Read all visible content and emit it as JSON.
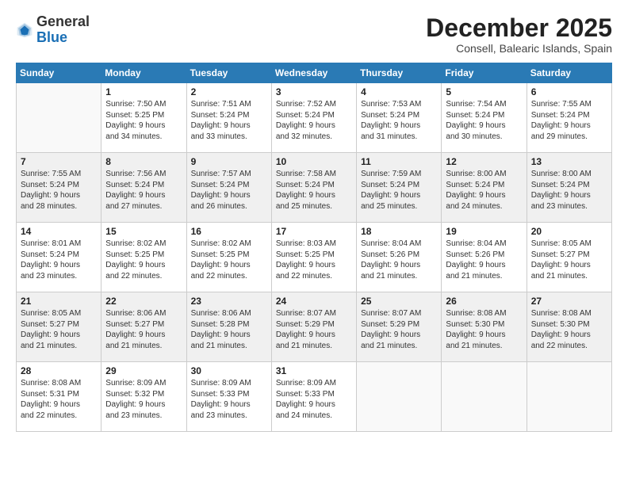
{
  "logo": {
    "general": "General",
    "blue": "Blue"
  },
  "header": {
    "month": "December 2025",
    "location": "Consell, Balearic Islands, Spain"
  },
  "weekdays": [
    "Sunday",
    "Monday",
    "Tuesday",
    "Wednesday",
    "Thursday",
    "Friday",
    "Saturday"
  ],
  "weeks": [
    [
      {
        "day": "",
        "sunrise": "",
        "sunset": "",
        "daylight": ""
      },
      {
        "day": "1",
        "sunrise": "Sunrise: 7:50 AM",
        "sunset": "Sunset: 5:25 PM",
        "daylight": "Daylight: 9 hours and 34 minutes."
      },
      {
        "day": "2",
        "sunrise": "Sunrise: 7:51 AM",
        "sunset": "Sunset: 5:24 PM",
        "daylight": "Daylight: 9 hours and 33 minutes."
      },
      {
        "day": "3",
        "sunrise": "Sunrise: 7:52 AM",
        "sunset": "Sunset: 5:24 PM",
        "daylight": "Daylight: 9 hours and 32 minutes."
      },
      {
        "day": "4",
        "sunrise": "Sunrise: 7:53 AM",
        "sunset": "Sunset: 5:24 PM",
        "daylight": "Daylight: 9 hours and 31 minutes."
      },
      {
        "day": "5",
        "sunrise": "Sunrise: 7:54 AM",
        "sunset": "Sunset: 5:24 PM",
        "daylight": "Daylight: 9 hours and 30 minutes."
      },
      {
        "day": "6",
        "sunrise": "Sunrise: 7:55 AM",
        "sunset": "Sunset: 5:24 PM",
        "daylight": "Daylight: 9 hours and 29 minutes."
      }
    ],
    [
      {
        "day": "7",
        "sunrise": "Sunrise: 7:55 AM",
        "sunset": "Sunset: 5:24 PM",
        "daylight": "Daylight: 9 hours and 28 minutes."
      },
      {
        "day": "8",
        "sunrise": "Sunrise: 7:56 AM",
        "sunset": "Sunset: 5:24 PM",
        "daylight": "Daylight: 9 hours and 27 minutes."
      },
      {
        "day": "9",
        "sunrise": "Sunrise: 7:57 AM",
        "sunset": "Sunset: 5:24 PM",
        "daylight": "Daylight: 9 hours and 26 minutes."
      },
      {
        "day": "10",
        "sunrise": "Sunrise: 7:58 AM",
        "sunset": "Sunset: 5:24 PM",
        "daylight": "Daylight: 9 hours and 25 minutes."
      },
      {
        "day": "11",
        "sunrise": "Sunrise: 7:59 AM",
        "sunset": "Sunset: 5:24 PM",
        "daylight": "Daylight: 9 hours and 25 minutes."
      },
      {
        "day": "12",
        "sunrise": "Sunrise: 8:00 AM",
        "sunset": "Sunset: 5:24 PM",
        "daylight": "Daylight: 9 hours and 24 minutes."
      },
      {
        "day": "13",
        "sunrise": "Sunrise: 8:00 AM",
        "sunset": "Sunset: 5:24 PM",
        "daylight": "Daylight: 9 hours and 23 minutes."
      }
    ],
    [
      {
        "day": "14",
        "sunrise": "Sunrise: 8:01 AM",
        "sunset": "Sunset: 5:24 PM",
        "daylight": "Daylight: 9 hours and 23 minutes."
      },
      {
        "day": "15",
        "sunrise": "Sunrise: 8:02 AM",
        "sunset": "Sunset: 5:25 PM",
        "daylight": "Daylight: 9 hours and 22 minutes."
      },
      {
        "day": "16",
        "sunrise": "Sunrise: 8:02 AM",
        "sunset": "Sunset: 5:25 PM",
        "daylight": "Daylight: 9 hours and 22 minutes."
      },
      {
        "day": "17",
        "sunrise": "Sunrise: 8:03 AM",
        "sunset": "Sunset: 5:25 PM",
        "daylight": "Daylight: 9 hours and 22 minutes."
      },
      {
        "day": "18",
        "sunrise": "Sunrise: 8:04 AM",
        "sunset": "Sunset: 5:26 PM",
        "daylight": "Daylight: 9 hours and 21 minutes."
      },
      {
        "day": "19",
        "sunrise": "Sunrise: 8:04 AM",
        "sunset": "Sunset: 5:26 PM",
        "daylight": "Daylight: 9 hours and 21 minutes."
      },
      {
        "day": "20",
        "sunrise": "Sunrise: 8:05 AM",
        "sunset": "Sunset: 5:27 PM",
        "daylight": "Daylight: 9 hours and 21 minutes."
      }
    ],
    [
      {
        "day": "21",
        "sunrise": "Sunrise: 8:05 AM",
        "sunset": "Sunset: 5:27 PM",
        "daylight": "Daylight: 9 hours and 21 minutes."
      },
      {
        "day": "22",
        "sunrise": "Sunrise: 8:06 AM",
        "sunset": "Sunset: 5:27 PM",
        "daylight": "Daylight: 9 hours and 21 minutes."
      },
      {
        "day": "23",
        "sunrise": "Sunrise: 8:06 AM",
        "sunset": "Sunset: 5:28 PM",
        "daylight": "Daylight: 9 hours and 21 minutes."
      },
      {
        "day": "24",
        "sunrise": "Sunrise: 8:07 AM",
        "sunset": "Sunset: 5:29 PM",
        "daylight": "Daylight: 9 hours and 21 minutes."
      },
      {
        "day": "25",
        "sunrise": "Sunrise: 8:07 AM",
        "sunset": "Sunset: 5:29 PM",
        "daylight": "Daylight: 9 hours and 21 minutes."
      },
      {
        "day": "26",
        "sunrise": "Sunrise: 8:08 AM",
        "sunset": "Sunset: 5:30 PM",
        "daylight": "Daylight: 9 hours and 21 minutes."
      },
      {
        "day": "27",
        "sunrise": "Sunrise: 8:08 AM",
        "sunset": "Sunset: 5:30 PM",
        "daylight": "Daylight: 9 hours and 22 minutes."
      }
    ],
    [
      {
        "day": "28",
        "sunrise": "Sunrise: 8:08 AM",
        "sunset": "Sunset: 5:31 PM",
        "daylight": "Daylight: 9 hours and 22 minutes."
      },
      {
        "day": "29",
        "sunrise": "Sunrise: 8:09 AM",
        "sunset": "Sunset: 5:32 PM",
        "daylight": "Daylight: 9 hours and 23 minutes."
      },
      {
        "day": "30",
        "sunrise": "Sunrise: 8:09 AM",
        "sunset": "Sunset: 5:33 PM",
        "daylight": "Daylight: 9 hours and 23 minutes."
      },
      {
        "day": "31",
        "sunrise": "Sunrise: 8:09 AM",
        "sunset": "Sunset: 5:33 PM",
        "daylight": "Daylight: 9 hours and 24 minutes."
      },
      {
        "day": "",
        "sunrise": "",
        "sunset": "",
        "daylight": ""
      },
      {
        "day": "",
        "sunrise": "",
        "sunset": "",
        "daylight": ""
      },
      {
        "day": "",
        "sunrise": "",
        "sunset": "",
        "daylight": ""
      }
    ]
  ]
}
